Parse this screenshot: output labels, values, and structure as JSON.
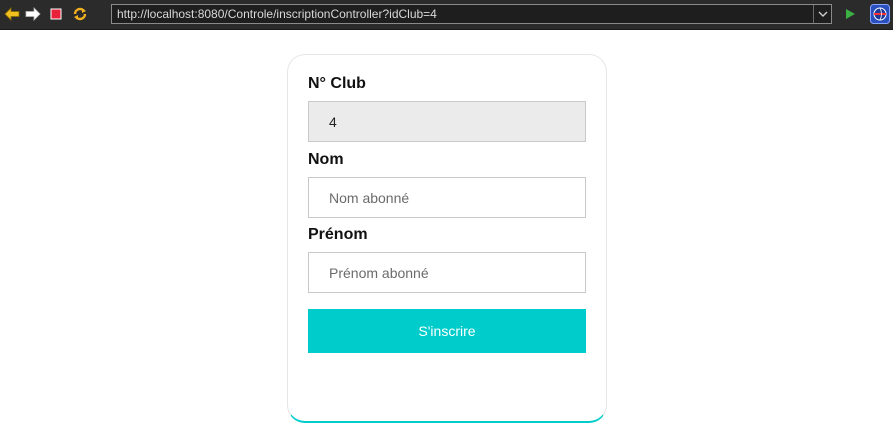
{
  "browser": {
    "url": "http://localhost:8080/Controle/inscriptionController?idClub=4",
    "icons": [
      "back-arrow-icon",
      "forward-arrow-icon",
      "stop-icon",
      "refresh-icon",
      "go-icon",
      "globe-icon"
    ]
  },
  "form": {
    "club_label": "N° Club",
    "club_value": "4",
    "nom_label": "Nom",
    "nom_placeholder": "Nom abonné",
    "prenom_label": "Prénom",
    "prenom_placeholder": "Prénom abonné",
    "submit_label": "S'inscrire"
  },
  "colors": {
    "accent": "#00cccc",
    "toolbar": "#2b2b2b",
    "readonly_bg": "#ebebeb"
  }
}
